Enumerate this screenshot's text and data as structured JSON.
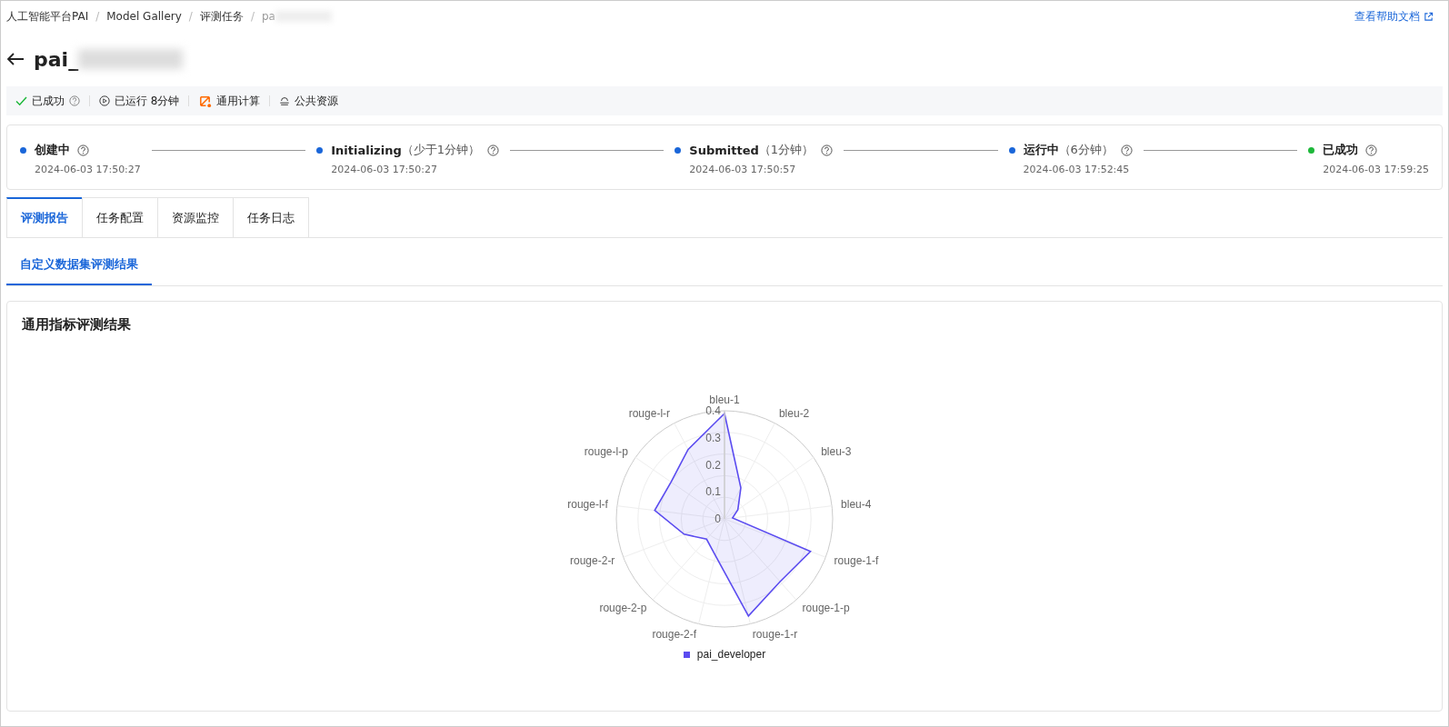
{
  "breadcrumbs": [
    {
      "label": "人工智能平台PAI",
      "current": false
    },
    {
      "label": "Model Gallery",
      "current": false
    },
    {
      "label": "评测任务",
      "current": false
    },
    {
      "label": "pa",
      "current": true
    }
  ],
  "breadcrumb_separator": "/",
  "help_link": {
    "label": "查看帮助文档"
  },
  "title": "pai_",
  "status_bar": [
    {
      "kind": "success",
      "label": "已成功"
    },
    {
      "kind": "duration",
      "label": "已运行 8分钟"
    },
    {
      "kind": "compute",
      "label": "通用计算"
    },
    {
      "kind": "resource",
      "label": "公共资源"
    }
  ],
  "timeline": [
    {
      "label": "创建中",
      "time": "2024-06-03 17:50:27",
      "color": "#1a66d9"
    },
    {
      "label": "Initializing",
      "duration": "（少于1分钟）",
      "time": "2024-06-03 17:50:27",
      "color": "#1a66d9"
    },
    {
      "label": "Submitted",
      "duration": "（1分钟）",
      "time": "2024-06-03 17:50:57",
      "color": "#1a66d9"
    },
    {
      "label": "运行中",
      "duration": "（6分钟）",
      "time": "2024-06-03 17:52:45",
      "color": "#1a66d9"
    },
    {
      "label": "已成功",
      "time": "2024-06-03 17:59:25",
      "color": "#1db83a"
    }
  ],
  "tabs": [
    {
      "label": "评测报告",
      "selected": true
    },
    {
      "label": "任务配置",
      "selected": false
    },
    {
      "label": "资源监控",
      "selected": false
    },
    {
      "label": "任务日志",
      "selected": false
    }
  ],
  "subtabs": [
    {
      "label": "自定义数据集评测结果",
      "selected": true
    }
  ],
  "panel": {
    "title": "通用指标评测结果",
    "chart_data": {
      "type": "radar",
      "categories": [
        "bleu-1",
        "bleu-2",
        "bleu-3",
        "bleu-4",
        "rouge-1-f",
        "rouge-1-p",
        "rouge-1-r",
        "rouge-2-f",
        "rouge-2-p",
        "rouge-2-r",
        "rouge-l-f",
        "rouge-l-p",
        "rouge-l-r"
      ],
      "series": [
        {
          "name": "pai_developer",
          "color": "#5b4cf0",
          "values": [
            0.39,
            0.13,
            0.06,
            0.03,
            0.34,
            0.31,
            0.37,
            0.14,
            0.1,
            0.16,
            0.26,
            0.24,
            0.29
          ]
        }
      ],
      "ylim": [
        0,
        0.4
      ],
      "yticks": [
        0,
        0.1,
        0.2,
        0.3,
        0.4
      ]
    }
  }
}
